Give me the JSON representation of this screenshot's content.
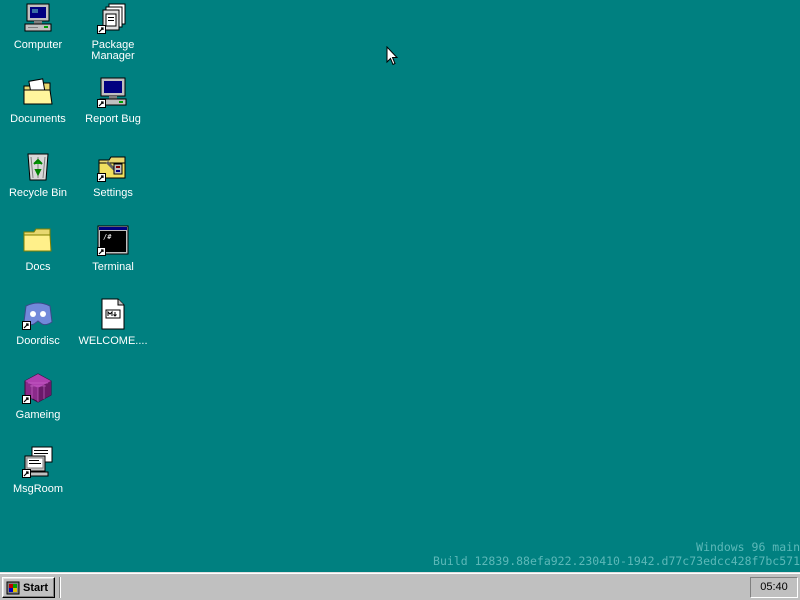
{
  "desktop": {
    "background_color": "#008080",
    "icons": [
      {
        "label": "Computer",
        "icon": "computer-icon",
        "shortcut": false
      },
      {
        "label": "Package Manager",
        "icon": "package-manager-icon",
        "shortcut": true
      },
      {
        "label": "Documents",
        "icon": "documents-folder-icon",
        "shortcut": false
      },
      {
        "label": "Report Bug",
        "icon": "report-bug-icon",
        "shortcut": true
      },
      {
        "label": "Recycle Bin",
        "icon": "recycle-bin-icon",
        "shortcut": false
      },
      {
        "label": "Settings",
        "icon": "settings-icon",
        "shortcut": true
      },
      {
        "label": "Docs",
        "icon": "folder-icon",
        "shortcut": false
      },
      {
        "label": "Terminal",
        "icon": "terminal-icon",
        "shortcut": true
      },
      {
        "label": "Doordisc",
        "icon": "doordisc-icon",
        "shortcut": true
      },
      {
        "label": "WELCOME....",
        "icon": "markdown-file-icon",
        "shortcut": false
      },
      {
        "label": "Gameing",
        "icon": "gameing-icon",
        "shortcut": true
      },
      {
        "label": "MsgRoom",
        "icon": "msgroom-icon",
        "shortcut": true
      }
    ]
  },
  "watermark": {
    "line1": "Windows 96 main",
    "line2": "Build 12839.88efa922.230410-1942.d77c73edcc428f7bc571"
  },
  "taskbar": {
    "start_label": "Start",
    "clock": "05:40"
  },
  "terminal_prompt_glyph": "/#"
}
